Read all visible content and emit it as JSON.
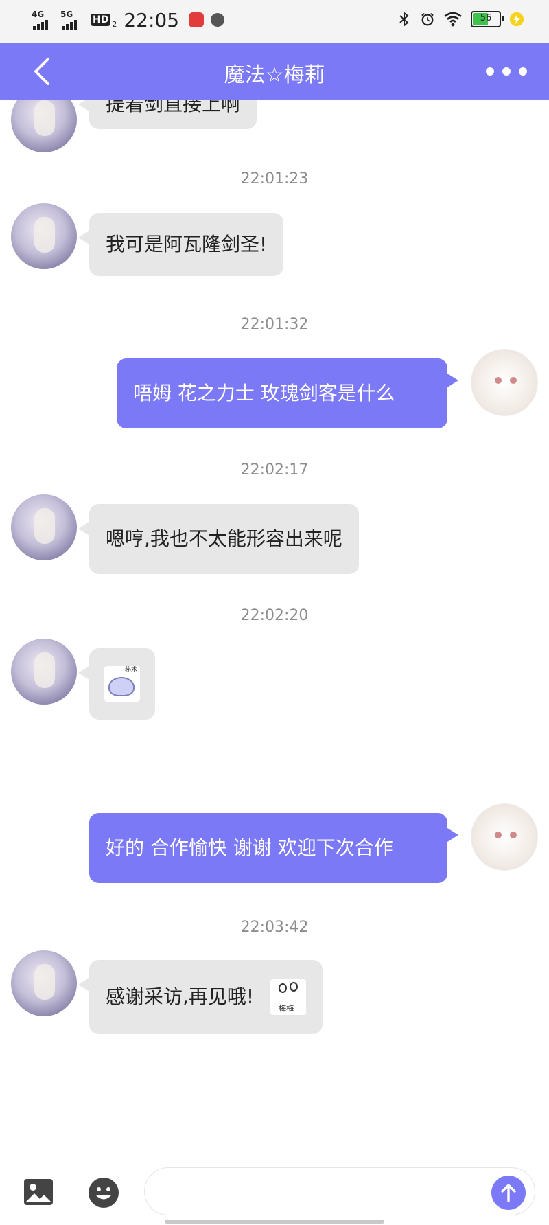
{
  "status_bar": {
    "network1": "4G",
    "network2": "5G",
    "hd_label": "HD",
    "hd_sub": "2",
    "time": "22:05",
    "battery": "56",
    "icons": [
      "bluetooth-icon",
      "alarm-icon",
      "wifi-icon",
      "battery-icon",
      "charging-icon"
    ]
  },
  "header": {
    "title": "魔法☆梅莉",
    "back_icon": "chevron-left-icon",
    "more_icon": "more-icon"
  },
  "messages": [
    {
      "side": "in",
      "text": "提着剑直接上啊"
    },
    {
      "timestamp": "22:01:23"
    },
    {
      "side": "in",
      "text": "我可是阿瓦隆剑圣!"
    },
    {
      "timestamp": "22:01:32"
    },
    {
      "side": "out",
      "text": "唔姆 花之力士 玫瑰剑客是什么"
    },
    {
      "timestamp": "22:02:17"
    },
    {
      "side": "in",
      "text": "嗯哼,我也不太能形容出来呢"
    },
    {
      "timestamp": "22:02:20"
    },
    {
      "side": "in",
      "sticker": "sticker"
    },
    {
      "side": "out",
      "text": "好的 合作愉快 谢谢 欢迎下次合作"
    },
    {
      "timestamp": "22:03:42"
    },
    {
      "side": "in",
      "text": "感谢采访,再见哦!",
      "sticker": "sticker"
    }
  ],
  "input_bar": {
    "image_icon": "image-icon",
    "emoji_icon": "emoji-icon",
    "placeholder": "",
    "send_icon": "send-icon"
  },
  "colors": {
    "accent": "#7b79f6",
    "incoming_bubble": "#e7e7e7",
    "timestamp": "#8c8c8c"
  }
}
